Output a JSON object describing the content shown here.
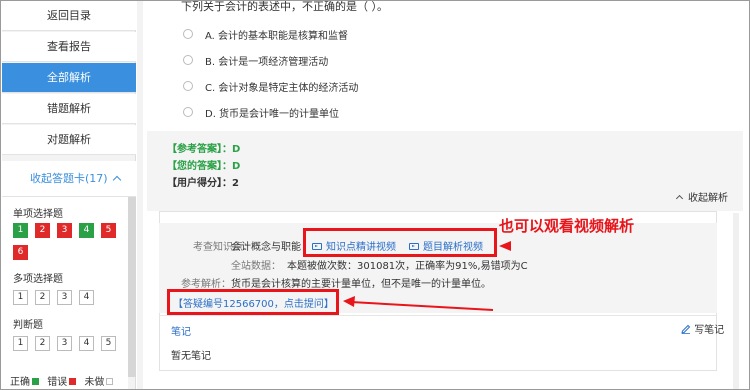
{
  "sidebar": {
    "nav": [
      {
        "label": "返回目录",
        "active": false
      },
      {
        "label": "查看报告",
        "active": false
      },
      {
        "label": "全部解析",
        "active": true
      },
      {
        "label": "错题解析",
        "active": false
      },
      {
        "label": "对题解析",
        "active": false
      }
    ],
    "card_toggle": "收起答题卡(17)",
    "sections": [
      {
        "title": "单项选择题",
        "items": [
          {
            "n": "1",
            "state": "correct"
          },
          {
            "n": "2",
            "state": "wrong"
          },
          {
            "n": "3",
            "state": "wrong"
          },
          {
            "n": "4",
            "state": "correct"
          },
          {
            "n": "5",
            "state": "wrong"
          },
          {
            "n": "6",
            "state": "wrong"
          }
        ]
      },
      {
        "title": "多项选择题",
        "items": [
          {
            "n": "1",
            "state": "none"
          },
          {
            "n": "2",
            "state": "none"
          },
          {
            "n": "3",
            "state": "none"
          },
          {
            "n": "4",
            "state": "none"
          }
        ]
      },
      {
        "title": "判断题",
        "items": [
          {
            "n": "1",
            "state": "none"
          },
          {
            "n": "2",
            "state": "none"
          },
          {
            "n": "3",
            "state": "none"
          },
          {
            "n": "4",
            "state": "none"
          },
          {
            "n": "5",
            "state": "none"
          }
        ]
      }
    ],
    "legend": {
      "correct": "正确",
      "wrong": "错误",
      "undone": "未做"
    },
    "colors": {
      "correct": "#2aa146",
      "wrong": "#e02a2a",
      "active_nav": "#3a8fde"
    }
  },
  "question": {
    "text": "下列关于会计的表述中，不正确的是（ ）。",
    "options": [
      "A. 会计的基本职能是核算和监督",
      "B. 会计是一项经济管理活动",
      "C. 会计对象是特定主体的经济活动",
      "D. 货币是会计唯一的计量单位"
    ]
  },
  "answer": {
    "reference": "【参考答案】：D",
    "yours": "【您的答案】：D",
    "score": "【用户得分】：2",
    "collapse": "收起解析"
  },
  "analysis": {
    "topic_label": "考查知识点：",
    "topic_value": "会计概念与职能",
    "video_point": "知识点精讲视频",
    "video_question": "题目解析视频",
    "stats_label": "全站数据：",
    "stats_value": "本题被做次数：301081次，正确率为91%,易错项为C",
    "ref_label": "参考解析：",
    "ref_value": "货币是会计核算的主要计量单位，但不是唯一的计量单位。",
    "question_link": "【答疑编号12566700，点击提问】",
    "annotation": "也可以观看视频解析"
  },
  "notes": {
    "label": "笔记",
    "write": "写笔记",
    "empty": "暂无笔记"
  }
}
